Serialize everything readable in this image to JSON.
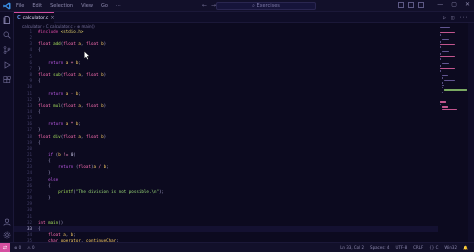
{
  "app": {
    "menu": [
      "File",
      "Edit",
      "Selection",
      "View",
      "Go",
      "···"
    ],
    "search_text": "Exercises",
    "window_controls": [
      "—",
      "▢",
      "✕"
    ]
  },
  "tab": {
    "name": "calculator.c",
    "close": "×"
  },
  "breadcrumb": "calculator › C calculator.c › ⊕ main()",
  "editor": {
    "lines": [
      {
        "n": "1",
        "tokens": [
          [
            "tk-pre",
            "#include "
          ],
          [
            "tk-inc",
            "<stdio.h>"
          ]
        ]
      },
      {
        "n": "2",
        "tokens": []
      },
      {
        "n": "3",
        "tokens": [
          [
            "tk-type",
            "float "
          ],
          [
            "tk-fn",
            "add"
          ],
          [
            "tk-punc",
            "("
          ],
          [
            "tk-type",
            "float "
          ],
          [
            "tk-var",
            "a"
          ],
          [
            "tk-punc",
            ", "
          ],
          [
            "tk-type",
            "float "
          ],
          [
            "tk-var",
            "b"
          ],
          [
            "tk-punc",
            ")"
          ]
        ]
      },
      {
        "n": "4",
        "tokens": [
          [
            "tk-punc",
            "{"
          ]
        ]
      },
      {
        "n": "5",
        "tokens": []
      },
      {
        "n": "6",
        "tokens": [
          [
            "tk-kw",
            "    return "
          ],
          [
            "tk-var",
            "a "
          ],
          [
            "tk-op",
            "+ "
          ],
          [
            "tk-var",
            "b"
          ],
          [
            "tk-punc",
            ";"
          ]
        ]
      },
      {
        "n": "7",
        "tokens": [
          [
            "tk-punc",
            "}"
          ]
        ]
      },
      {
        "n": "8",
        "tokens": [
          [
            "tk-type",
            "float "
          ],
          [
            "tk-fn",
            "sub"
          ],
          [
            "tk-punc",
            "("
          ],
          [
            "tk-type",
            "float "
          ],
          [
            "tk-var",
            "a"
          ],
          [
            "tk-punc",
            ", "
          ],
          [
            "tk-type",
            "float "
          ],
          [
            "tk-var",
            "b"
          ],
          [
            "tk-punc",
            ")"
          ]
        ]
      },
      {
        "n": "9",
        "tokens": [
          [
            "tk-punc",
            "{"
          ]
        ]
      },
      {
        "n": "10",
        "tokens": []
      },
      {
        "n": "11",
        "tokens": [
          [
            "tk-kw",
            "    return "
          ],
          [
            "tk-var",
            "a "
          ],
          [
            "tk-op",
            "- "
          ],
          [
            "tk-var",
            "b"
          ],
          [
            "tk-punc",
            ";"
          ]
        ]
      },
      {
        "n": "12",
        "tokens": [
          [
            "tk-punc",
            "}"
          ]
        ]
      },
      {
        "n": "13",
        "tokens": [
          [
            "tk-type",
            "float "
          ],
          [
            "tk-fn",
            "mul"
          ],
          [
            "tk-punc",
            "("
          ],
          [
            "tk-type",
            "float "
          ],
          [
            "tk-var",
            "a"
          ],
          [
            "tk-punc",
            ", "
          ],
          [
            "tk-type",
            "float "
          ],
          [
            "tk-var",
            "b"
          ],
          [
            "tk-punc",
            ")"
          ]
        ]
      },
      {
        "n": "14",
        "tokens": [
          [
            "tk-punc",
            "{"
          ]
        ]
      },
      {
        "n": "15",
        "tokens": []
      },
      {
        "n": "16",
        "tokens": [
          [
            "tk-kw",
            "    return "
          ],
          [
            "tk-var",
            "a "
          ],
          [
            "tk-op",
            "* "
          ],
          [
            "tk-var",
            "b"
          ],
          [
            "tk-punc",
            ";"
          ]
        ]
      },
      {
        "n": "17",
        "tokens": [
          [
            "tk-punc",
            "}"
          ]
        ]
      },
      {
        "n": "18",
        "tokens": [
          [
            "tk-type",
            "float "
          ],
          [
            "tk-fn",
            "div"
          ],
          [
            "tk-punc",
            "("
          ],
          [
            "tk-type",
            "float "
          ],
          [
            "tk-var",
            "a"
          ],
          [
            "tk-punc",
            ", "
          ],
          [
            "tk-type",
            "float "
          ],
          [
            "tk-var",
            "b"
          ],
          [
            "tk-punc",
            ")"
          ]
        ]
      },
      {
        "n": "19",
        "tokens": [
          [
            "tk-punc",
            "{"
          ]
        ]
      },
      {
        "n": "20",
        "tokens": []
      },
      {
        "n": "21",
        "tokens": [
          [
            "tk-kw",
            "    if "
          ],
          [
            "tk-punc",
            "("
          ],
          [
            "tk-var",
            "b "
          ],
          [
            "tk-op",
            "!= "
          ],
          [
            "tk-plain",
            "0"
          ],
          [
            "tk-punc",
            ")"
          ]
        ]
      },
      {
        "n": "22",
        "tokens": [
          [
            "tk-punc",
            "    {"
          ]
        ]
      },
      {
        "n": "23",
        "tokens": [
          [
            "tk-kw",
            "        return "
          ],
          [
            "tk-punc",
            "("
          ],
          [
            "tk-type",
            "float"
          ],
          [
            "tk-punc",
            ")"
          ],
          [
            "tk-var",
            "a "
          ],
          [
            "tk-op",
            "/ "
          ],
          [
            "tk-var",
            "b"
          ],
          [
            "tk-punc",
            ";"
          ]
        ]
      },
      {
        "n": "24",
        "tokens": [
          [
            "tk-punc",
            "    }"
          ]
        ]
      },
      {
        "n": "25",
        "tokens": [
          [
            "tk-kw",
            "    else"
          ]
        ]
      },
      {
        "n": "26",
        "tokens": [
          [
            "tk-punc",
            "    {"
          ]
        ]
      },
      {
        "n": "27",
        "tokens": [
          [
            "tk-fn",
            "        printf"
          ],
          [
            "tk-punc",
            "("
          ],
          [
            "tk-str",
            "\"The division is not possible.\\n\""
          ],
          [
            "tk-punc",
            ");"
          ]
        ]
      },
      {
        "n": "28",
        "tokens": [
          [
            "tk-punc",
            "    }"
          ]
        ]
      },
      {
        "n": "29",
        "tokens": []
      },
      {
        "n": "30",
        "tokens": []
      },
      {
        "n": "31",
        "tokens": []
      },
      {
        "n": "32",
        "tokens": [
          [
            "tk-type",
            "int "
          ],
          [
            "tk-fn",
            "main"
          ],
          [
            "tk-punc",
            "()"
          ]
        ]
      },
      {
        "n": "33",
        "tokens": [
          [
            "tk-punc",
            "{"
          ]
        ]
      },
      {
        "n": "34",
        "tokens": [
          [
            "tk-type",
            "    float "
          ],
          [
            "tk-var",
            "a"
          ],
          [
            "tk-punc",
            ", "
          ],
          [
            "tk-var",
            "b"
          ],
          [
            "tk-punc",
            ";"
          ]
        ]
      },
      {
        "n": "35",
        "tokens": [
          [
            "tk-type",
            "    char "
          ],
          [
            "tk-var",
            "operator"
          ],
          [
            "tk-punc",
            ", "
          ],
          [
            "tk-var",
            "continueChar"
          ],
          [
            "tk-punc",
            ";"
          ]
        ]
      }
    ]
  },
  "status": {
    "remote_icon": "⇄",
    "left": [
      "⊗ 0",
      "⚠ 0"
    ],
    "right": [
      "Ln 33, Col 2",
      "Spaces: 4",
      "UTF-8",
      "CRLF",
      "{} C",
      "Win32",
      "🔔"
    ]
  },
  "colors": {
    "accent": "#d44fa0",
    "background": "#0c0a1f"
  }
}
